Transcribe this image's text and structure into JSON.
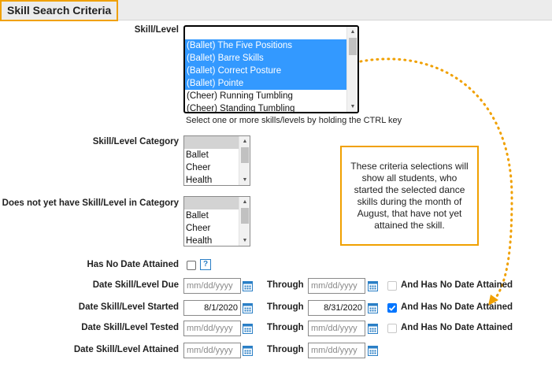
{
  "header": {
    "title": "Skill Search Criteria"
  },
  "skill_level": {
    "label": "Skill/Level",
    "items": [
      {
        "text": "",
        "selected": false
      },
      {
        "text": "(Ballet) The Five Positions",
        "selected": true
      },
      {
        "text": "(Ballet) Barre Skills",
        "selected": true
      },
      {
        "text": "(Ballet) Correct Posture",
        "selected": true
      },
      {
        "text": "(Ballet) Pointe",
        "selected": true
      },
      {
        "text": "(Cheer) Running Tumbling",
        "selected": false
      },
      {
        "text": "(Cheer) Standing Tumbling",
        "selected": false
      }
    ],
    "hint": "Select one or more skills/levels by holding the CTRL key"
  },
  "skill_category": {
    "label": "Skill/Level Category",
    "items": [
      "",
      "Ballet",
      "Cheer",
      "Health"
    ]
  },
  "not_yet_category": {
    "label": "Does not yet have Skill/Level in Category",
    "items": [
      "",
      "Ballet",
      "Cheer",
      "Health"
    ]
  },
  "no_date_attained": {
    "label": "Has No Date Attained",
    "checked": false,
    "help": "?"
  },
  "date_rows": [
    {
      "label": "Date Skill/Level Due",
      "from": "",
      "to": "",
      "through": "Through",
      "extra": "And Has No Date Attained",
      "extra_checked": false
    },
    {
      "label": "Date Skill/Level Started",
      "from": "8/1/2020",
      "to": "8/31/2020",
      "through": "Through",
      "extra": "And Has No Date Attained",
      "extra_checked": true
    },
    {
      "label": "Date Skill/Level Tested",
      "from": "",
      "to": "",
      "through": "Through",
      "extra": "And Has No Date Attained",
      "extra_checked": false
    },
    {
      "label": "Date Skill/Level Attained",
      "from": "",
      "to": "",
      "through": "Through",
      "extra": "",
      "extra_checked": false
    }
  ],
  "date_placeholder": "mm/dd/yyyy",
  "callout": {
    "text": "These criteria selections will show all students, who started the selected dance skills during the month of August, that have not yet attained the skill."
  },
  "colors": {
    "accent": "#f0a000",
    "selection": "#3399ff",
    "calendar": "#2a7fc6"
  },
  "icons": {
    "calendar": "calendar-icon",
    "help": "help-icon"
  }
}
